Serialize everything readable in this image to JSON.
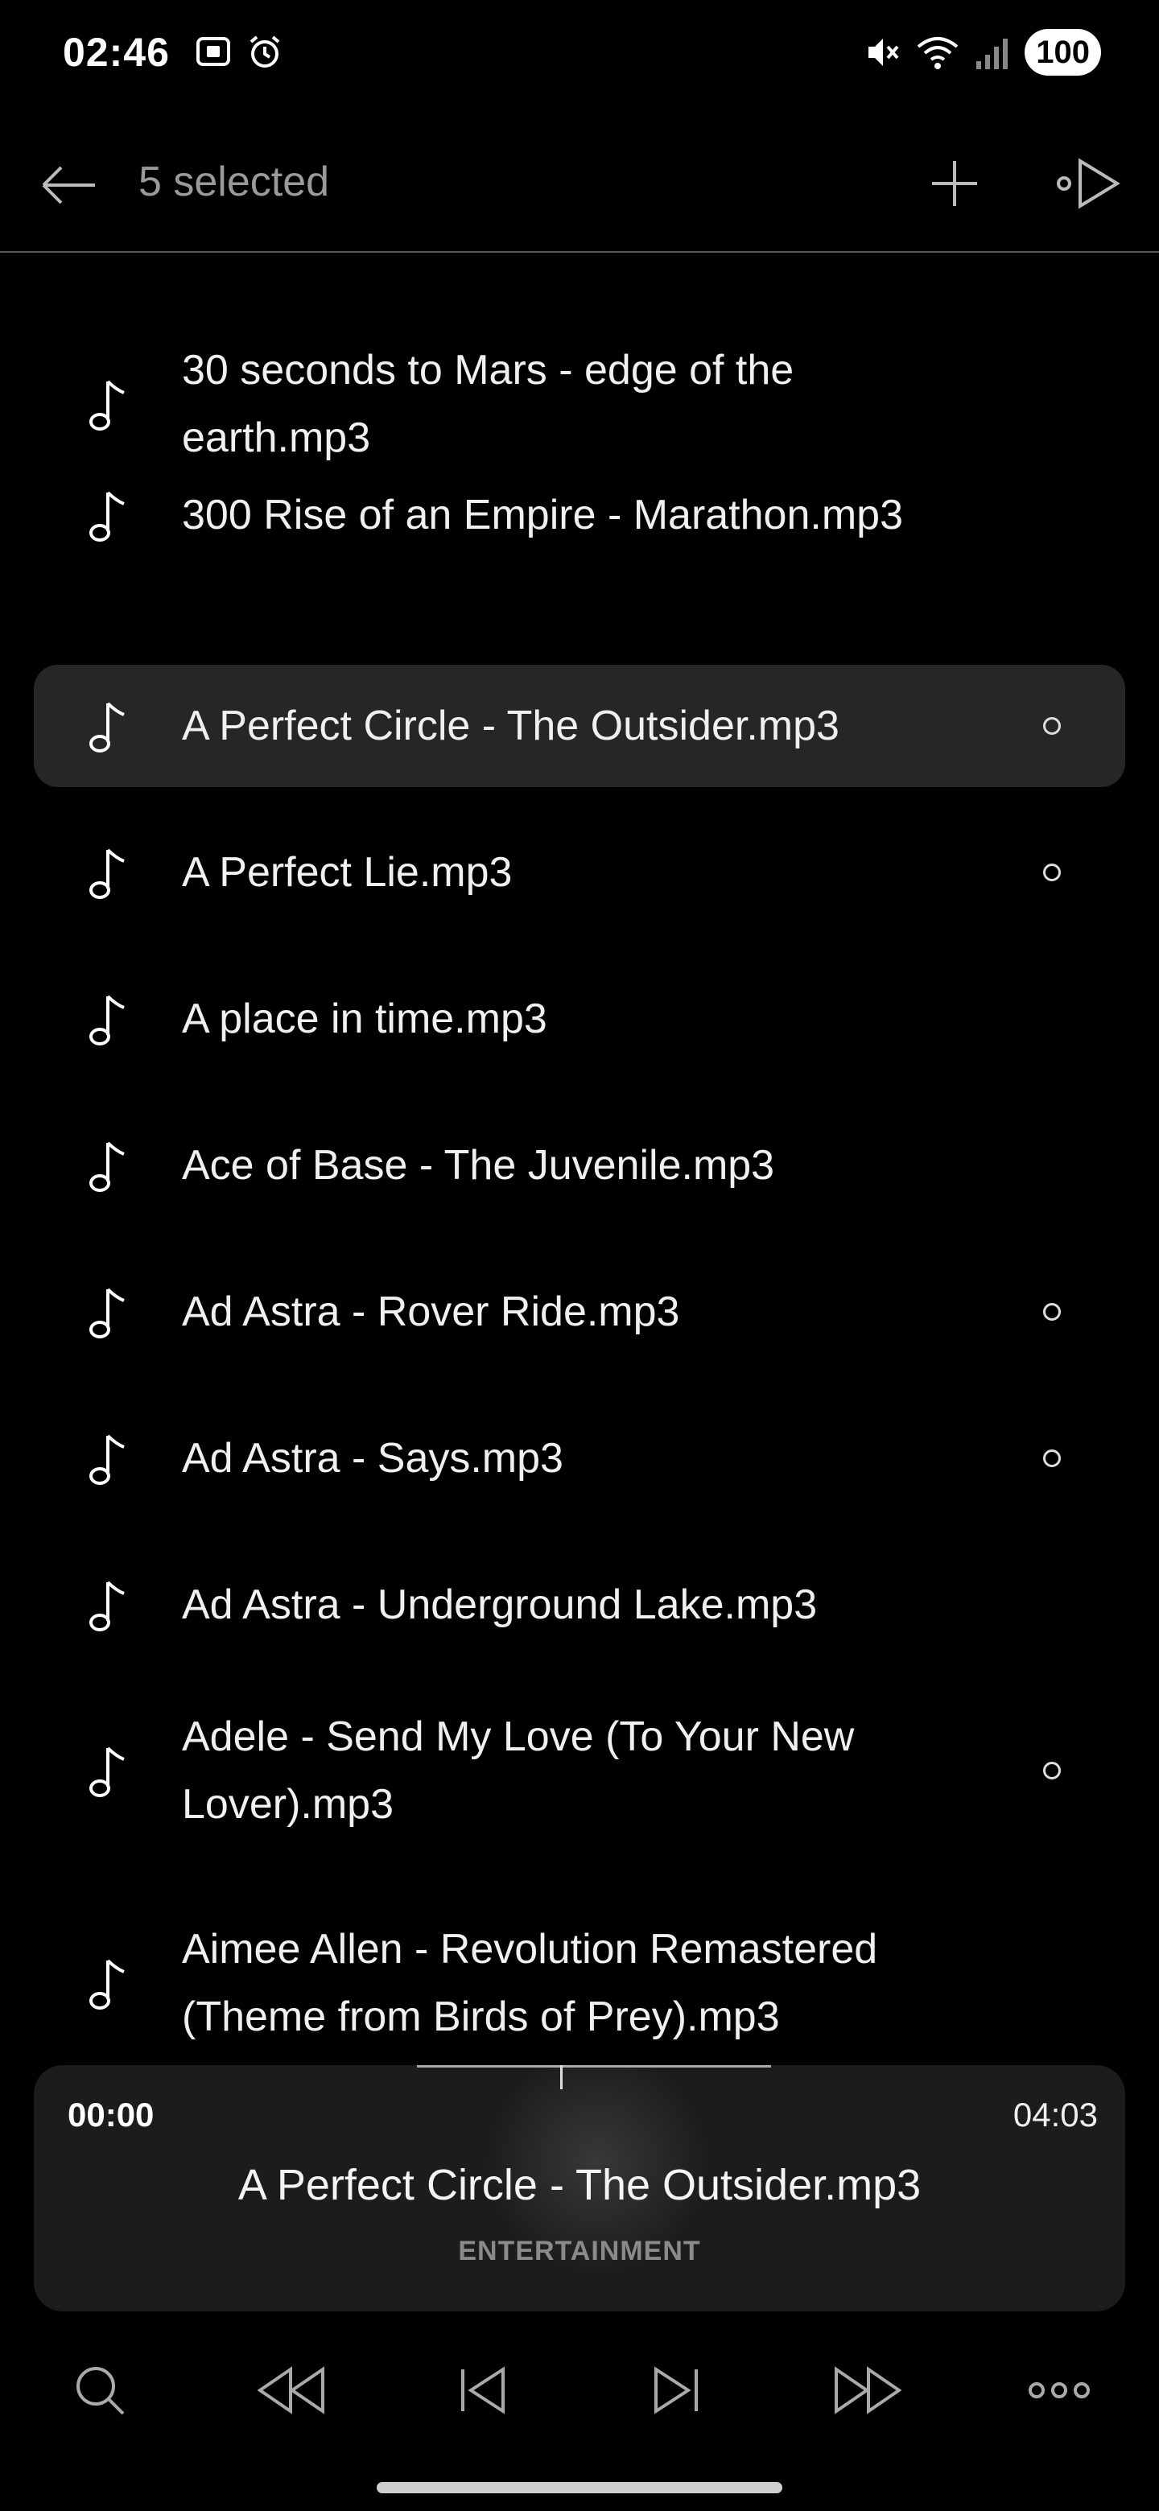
{
  "status_bar": {
    "time": "02:46",
    "battery": "100",
    "icons": [
      "screen-record-icon",
      "alarm-icon",
      "mute-icon",
      "wifi-icon",
      "signal-icon"
    ]
  },
  "app_bar": {
    "title": "5 selected",
    "icons": [
      "back-arrow-icon",
      "plus-icon",
      "play-next-icon"
    ]
  },
  "tracks": [
    {
      "name": "30 seconds to Mars - edge of the earth.mp3",
      "highlighted": false,
      "dot": false
    },
    {
      "name": "300 Rise of an Empire - Marathon.mp3",
      "highlighted": false,
      "dot": false
    },
    {
      "name": "A Perfect Circle - The Outsider.mp3",
      "highlighted": true,
      "dot": true
    },
    {
      "name": "A Perfect Lie.mp3",
      "highlighted": false,
      "dot": true
    },
    {
      "name": "A place in time.mp3",
      "highlighted": false,
      "dot": false
    },
    {
      "name": "Ace of Base - The Juvenile.mp3",
      "highlighted": false,
      "dot": false
    },
    {
      "name": "Ad Astra - Rover Ride.mp3",
      "highlighted": false,
      "dot": true
    },
    {
      "name": "Ad Astra - Says.mp3",
      "highlighted": false,
      "dot": true
    },
    {
      "name": "Ad Astra - Underground Lake.mp3",
      "highlighted": false,
      "dot": false
    },
    {
      "name": "Adele - Send My Love (To Your New Lover).mp3",
      "highlighted": false,
      "dot": true
    },
    {
      "name": "Aimee Allen - Revolution Remastered (Theme from Birds of Prey).mp3",
      "highlighted": false,
      "dot": false
    }
  ],
  "player": {
    "current_time": "00:00",
    "total_time": "04:03",
    "title": "A Perfect Circle - The Outsider.mp3",
    "subtitle": "ENTERTAINMENT",
    "progress": 0
  },
  "controls": [
    "search-icon",
    "rewind-icon",
    "previous-icon",
    "next-icon",
    "fast-forward-icon",
    "more-icon"
  ],
  "colors": {
    "background": "#000000",
    "highlight_row": "#262626",
    "player_bg": "#1c1c1c",
    "muted_text": "#9a9a9a"
  }
}
